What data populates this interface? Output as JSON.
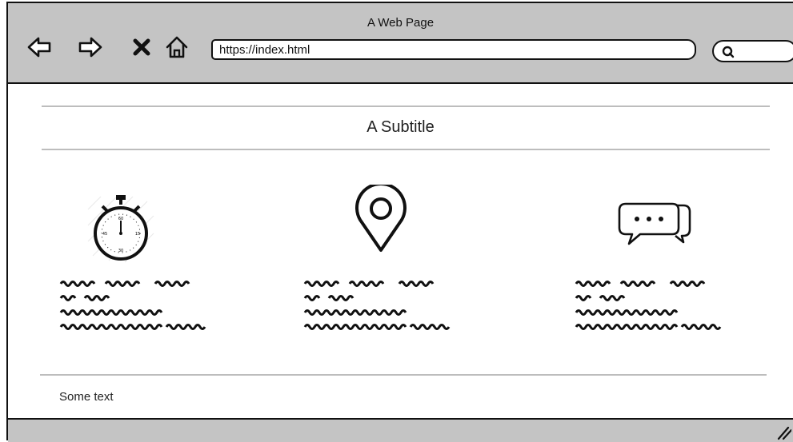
{
  "window": {
    "title": "A Web Page"
  },
  "toolbar": {
    "back_icon": "arrow-left-icon",
    "forward_icon": "arrow-right-icon",
    "stop_icon": "close-icon",
    "home_icon": "home-icon",
    "url": "https://index.html",
    "search_icon": "search-icon"
  },
  "page": {
    "subtitle": "A Subtitle",
    "features": [
      {
        "icon": "stopwatch-icon"
      },
      {
        "icon": "location-pin-icon"
      },
      {
        "icon": "chat-bubbles-icon"
      }
    ],
    "footer_text": "Some text"
  }
}
